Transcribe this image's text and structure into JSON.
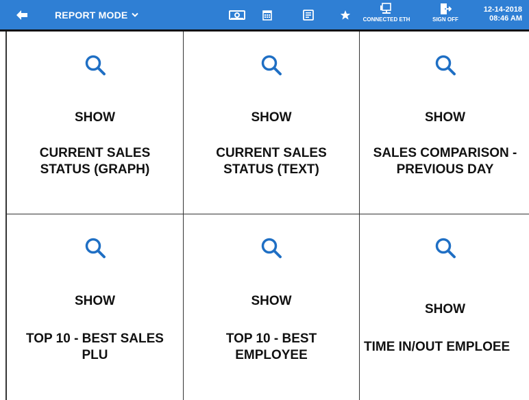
{
  "header": {
    "mode_label": "REPORT MODE",
    "connection_label": "CONNECTED ETH",
    "signoff_label": "SIGN OFF",
    "date": "12-14-2018",
    "time": "08:46 AM"
  },
  "colors": {
    "topbar": "#2f7fd4",
    "search_icon": "#1f6fc4"
  },
  "icons": {
    "back": "arrow-left-icon",
    "mode": "chevron-down-icon",
    "cash": "cash-icon",
    "calendar": "calendar-icon",
    "list": "list-icon",
    "star": "star-icon",
    "connection": "monitor-icon",
    "signoff": "exit-door-icon",
    "tile": "search-icon"
  },
  "tiles": [
    {
      "show": "SHOW",
      "line1": "CURRENT SALES",
      "line2": "STATUS (GRAPH)"
    },
    {
      "show": "SHOW",
      "line1": "CURRENT SALES",
      "line2": "STATUS (TEXT)"
    },
    {
      "show": "SHOW",
      "line1": "SALES COMPARISON -",
      "line2": "PREVIOUS DAY"
    },
    {
      "show": "SHOW",
      "line1": "TOP 10 - BEST SALES",
      "line2": "PLU"
    },
    {
      "show": "SHOW",
      "line1": "TOP 10 - BEST",
      "line2": "EMPLOYEE"
    },
    {
      "show": "SHOW",
      "line1": "TIME IN/OUT EMPLOEE",
      "line2": ""
    }
  ]
}
